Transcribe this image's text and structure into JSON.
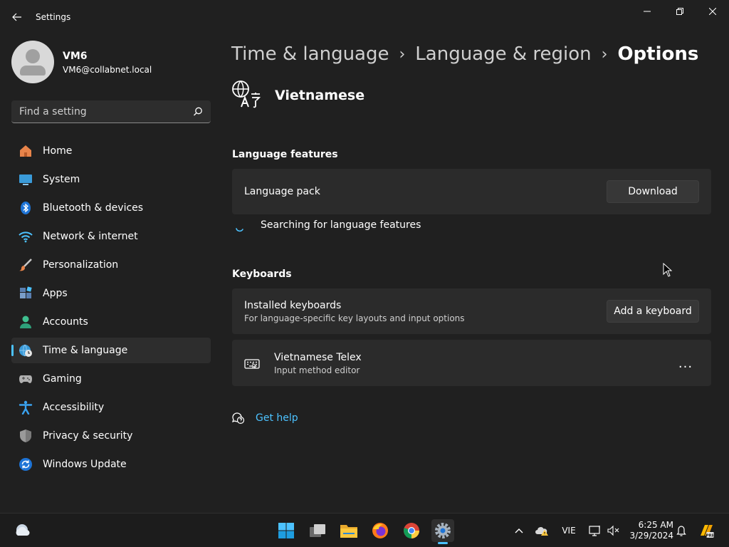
{
  "window": {
    "title": "Settings",
    "back_icon": "arrow-left-icon",
    "controls": [
      "minimize-icon",
      "maximize-icon",
      "close-icon"
    ]
  },
  "profile": {
    "name": "VM6",
    "email": "VM6@collabnet.local"
  },
  "search": {
    "placeholder": "Find a setting",
    "value": ""
  },
  "sidebar": {
    "items": [
      {
        "label": "Home",
        "icon": "home-icon",
        "active": false
      },
      {
        "label": "System",
        "icon": "system-icon",
        "active": false
      },
      {
        "label": "Bluetooth & devices",
        "icon": "bluetooth-icon",
        "active": false
      },
      {
        "label": "Network & internet",
        "icon": "wifi-icon",
        "active": false
      },
      {
        "label": "Personalization",
        "icon": "brush-icon",
        "active": false
      },
      {
        "label": "Apps",
        "icon": "apps-icon",
        "active": false
      },
      {
        "label": "Accounts",
        "icon": "accounts-icon",
        "active": false
      },
      {
        "label": "Time & language",
        "icon": "globe-clock-icon",
        "active": true
      },
      {
        "label": "Gaming",
        "icon": "gamepad-icon",
        "active": false
      },
      {
        "label": "Accessibility",
        "icon": "accessibility-icon",
        "active": false
      },
      {
        "label": "Privacy & security",
        "icon": "shield-icon",
        "active": false
      },
      {
        "label": "Windows Update",
        "icon": "update-icon",
        "active": false
      }
    ]
  },
  "breadcrumb": {
    "items": [
      "Time & language",
      "Language & region"
    ],
    "current": "Options"
  },
  "language": {
    "name": "Vietnamese",
    "icon": "language-icon"
  },
  "language_features": {
    "title": "Language features",
    "pack_label": "Language pack",
    "download_label": "Download",
    "status": "Searching for language features"
  },
  "keyboards": {
    "title": "Keyboards",
    "installed_label": "Installed keyboards",
    "installed_desc": "For language-specific key layouts and input options",
    "add_label": "Add a keyboard",
    "keyboard_name": "Vietnamese Telex",
    "keyboard_type": "Input method editor",
    "more_label": "..."
  },
  "help": {
    "label": "Get help"
  },
  "taskbar": {
    "apps": [
      "start-icon",
      "task-view-icon",
      "file-explorer-icon",
      "firefox-icon",
      "chrome-icon",
      "settings-icon"
    ],
    "language_indicator": "VIE",
    "time": "6:25 AM",
    "date": "3/29/2024"
  },
  "colors": {
    "accent": "#4cc2ff",
    "background": "#202020",
    "card": "#2b2b2b"
  }
}
